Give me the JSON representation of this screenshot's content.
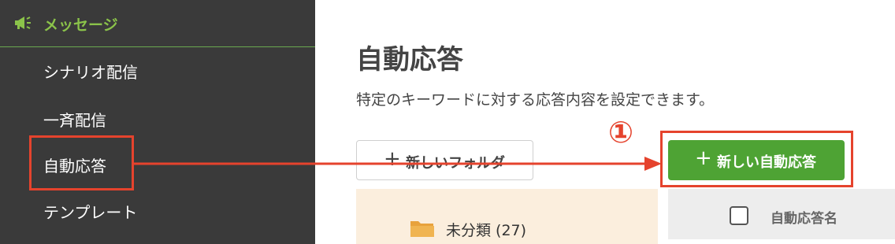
{
  "sidebar": {
    "header": {
      "label": "メッセージ",
      "icon": "megaphone-icon"
    },
    "items": [
      {
        "label": "シナリオ配信"
      },
      {
        "label": "一斉配信"
      },
      {
        "label": "自動応答"
      },
      {
        "label": "テンプレート"
      }
    ]
  },
  "main": {
    "title": "自動応答",
    "description": "特定のキーワードに対する応答内容を設定できます。",
    "new_folder_button": {
      "plus": "+",
      "label": "新しいフォルダ"
    },
    "new_autoreply_button": {
      "plus": "+",
      "label": "新しい自動応答"
    },
    "step_marker": "①",
    "folders": [
      {
        "label": "未分類 (27)",
        "icon": "folder-icon"
      }
    ],
    "table": {
      "column_header": "自動応答名"
    }
  },
  "colors": {
    "sidebar_bg": "#3a3a3a",
    "sidebar_accent": "#8bc34a",
    "highlight": "#e5432d",
    "primary_button": "#4ea334",
    "folder_panel_bg": "#fbeedd",
    "table_header_bg": "#ededed"
  }
}
